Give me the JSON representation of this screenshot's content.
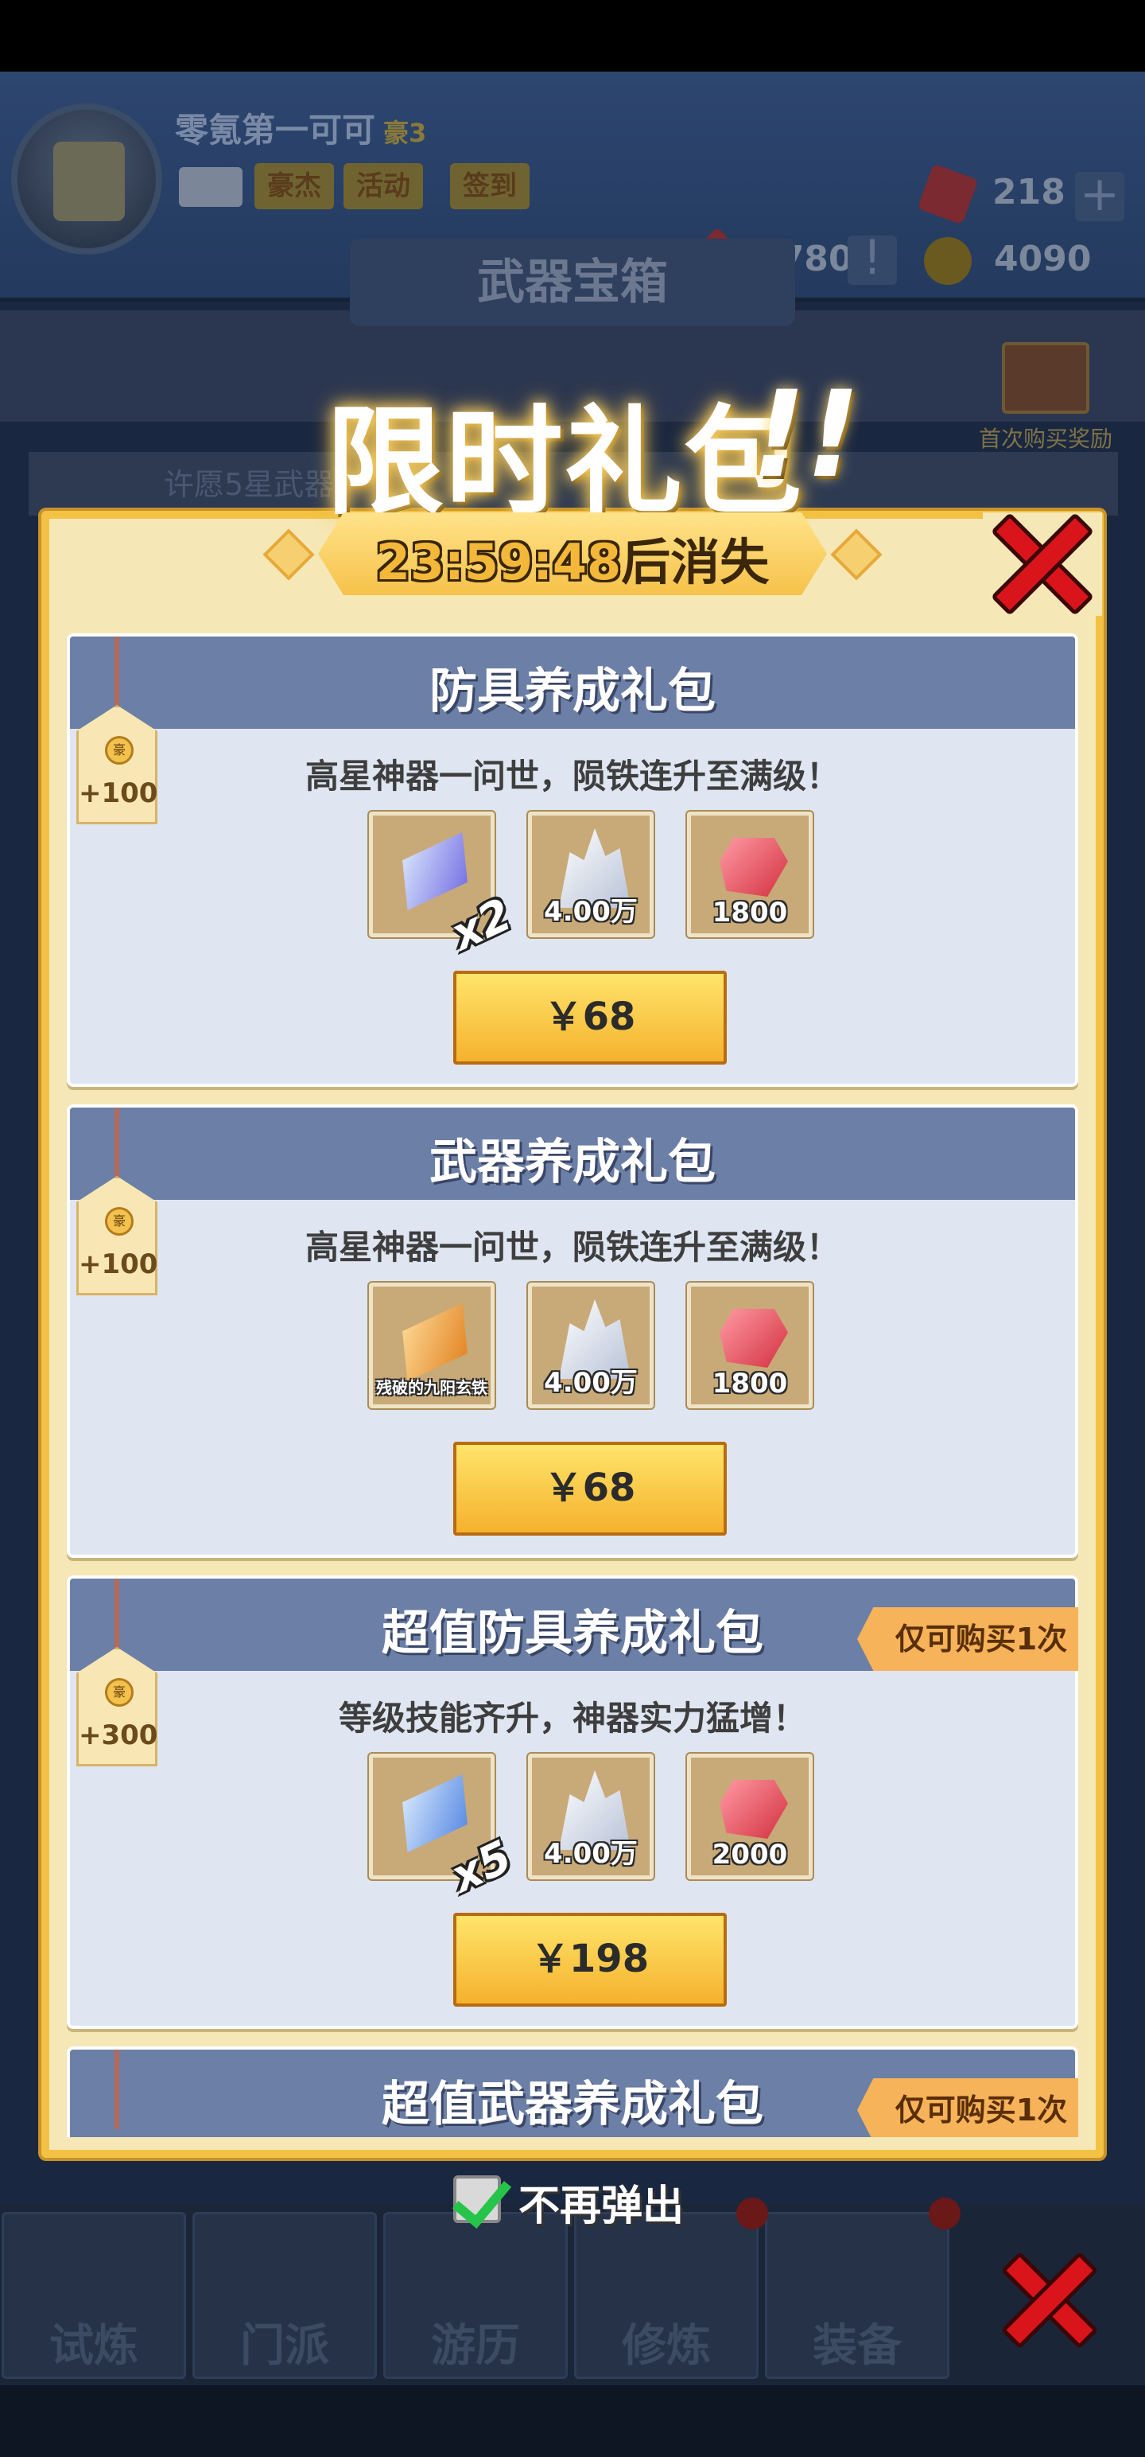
{
  "player": {
    "name": "零氪第一可可",
    "rank": "豪3",
    "buttons": [
      "豪杰",
      "活动",
      "签到"
    ],
    "gems": "218",
    "crystals": "8780",
    "coins": "4090"
  },
  "background": {
    "chest_title": "武器宝箱",
    "first_buy_reward": "首次购买奖励",
    "notice": "许愿5星武器",
    "nav": [
      "试炼",
      "门派",
      "游历",
      "修炼",
      "装备"
    ]
  },
  "popup": {
    "title": "限时礼包",
    "title_mark": "!!",
    "timer": "23:59:48",
    "timer_suffix": "后消失",
    "packs": [
      {
        "title": "防具养成礼包",
        "desc": "高星神器一问世，陨铁连升至满级！",
        "points": "+100",
        "coin_label": "豪",
        "items": [
          {
            "icon": "purple-ingot-icon",
            "count": "",
            "multiplier": "x2"
          },
          {
            "icon": "crystal-icon",
            "count": "4.00万"
          },
          {
            "icon": "ruby-icon",
            "count": "1800"
          }
        ],
        "price": "￥68",
        "limit": ""
      },
      {
        "title": "武器养成礼包",
        "desc": "高星神器一问世，陨铁连升至满级！",
        "points": "+100",
        "coin_label": "豪",
        "items": [
          {
            "icon": "orange-ingot-icon",
            "count": "残破的九阳玄铁"
          },
          {
            "icon": "crystal-icon",
            "count": "4.00万"
          },
          {
            "icon": "ruby-icon",
            "count": "1800"
          }
        ],
        "price": "￥68",
        "limit": ""
      },
      {
        "title": "超值防具养成礼包",
        "desc": "等级技能齐升，神器实力猛增！",
        "points": "+300",
        "coin_label": "豪",
        "items": [
          {
            "icon": "blue-ingot-icon",
            "count": "",
            "multiplier": "x5"
          },
          {
            "icon": "crystal-icon",
            "count": "4.00万"
          },
          {
            "icon": "ruby-icon",
            "count": "2000"
          }
        ],
        "price": "￥198",
        "limit": "仅可购买1次"
      },
      {
        "title": "超值武器养成礼包",
        "limit": "仅可购买1次"
      }
    ],
    "dont_show_again": "不再弹出"
  }
}
